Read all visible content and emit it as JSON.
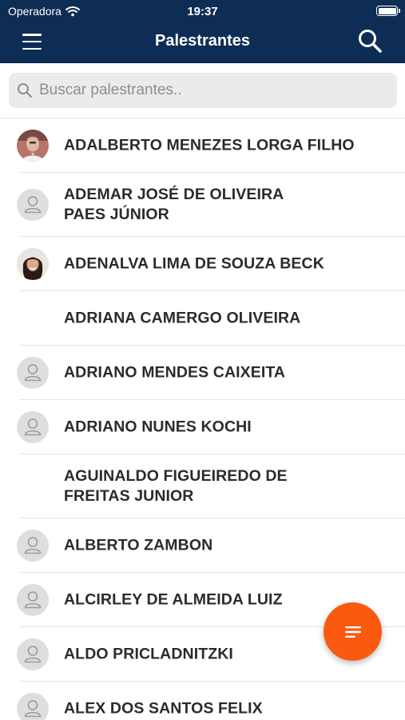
{
  "status": {
    "carrier": "Operadora",
    "time": "19:37"
  },
  "header": {
    "title": "Palestrantes"
  },
  "search": {
    "placeholder": "Buscar palestrantes.."
  },
  "speakers": [
    {
      "line1": "ADALBERTO MENEZES LORGA FILHO",
      "line2": "",
      "avatar": "photo-man"
    },
    {
      "line1": "ADEMAR JOSÉ DE OLIVEIRA",
      "line2": "PAES JÚNIOR",
      "avatar": "placeholder"
    },
    {
      "line1": "ADENALVA LIMA DE SOUZA BECK",
      "line2": "",
      "avatar": "photo-woman"
    },
    {
      "line1": "ADRIANA CAMERGO OLIVEIRA",
      "line2": "",
      "avatar": "blank"
    },
    {
      "line1": "ADRIANO MENDES CAIXEITA",
      "line2": "",
      "avatar": "placeholder"
    },
    {
      "line1": "ADRIANO NUNES KOCHI",
      "line2": "",
      "avatar": "placeholder"
    },
    {
      "line1": "AGUINALDO FIGUEIREDO DE",
      "line2": "FREITAS JUNIOR",
      "avatar": "blank"
    },
    {
      "line1": "ALBERTO ZAMBON",
      "line2": "",
      "avatar": "placeholder"
    },
    {
      "line1": "ALCIRLEY DE ALMEIDA LUIZ",
      "line2": "",
      "avatar": "placeholder"
    },
    {
      "line1": "ALDO PRICLADNITZKI",
      "line2": "",
      "avatar": "placeholder"
    },
    {
      "line1": "ALEX DOS SANTOS FELIX",
      "line2": "",
      "avatar": "placeholder"
    }
  ],
  "icons": {
    "menu": "hamburger-icon",
    "search": "magnifier-icon",
    "fab": "filter-lines-icon",
    "wifi": "wifi-icon",
    "battery": "battery-icon"
  },
  "colors": {
    "header": "#0e2d55",
    "fab": "#fa5a0f",
    "search_bg": "#ebebeb"
  }
}
